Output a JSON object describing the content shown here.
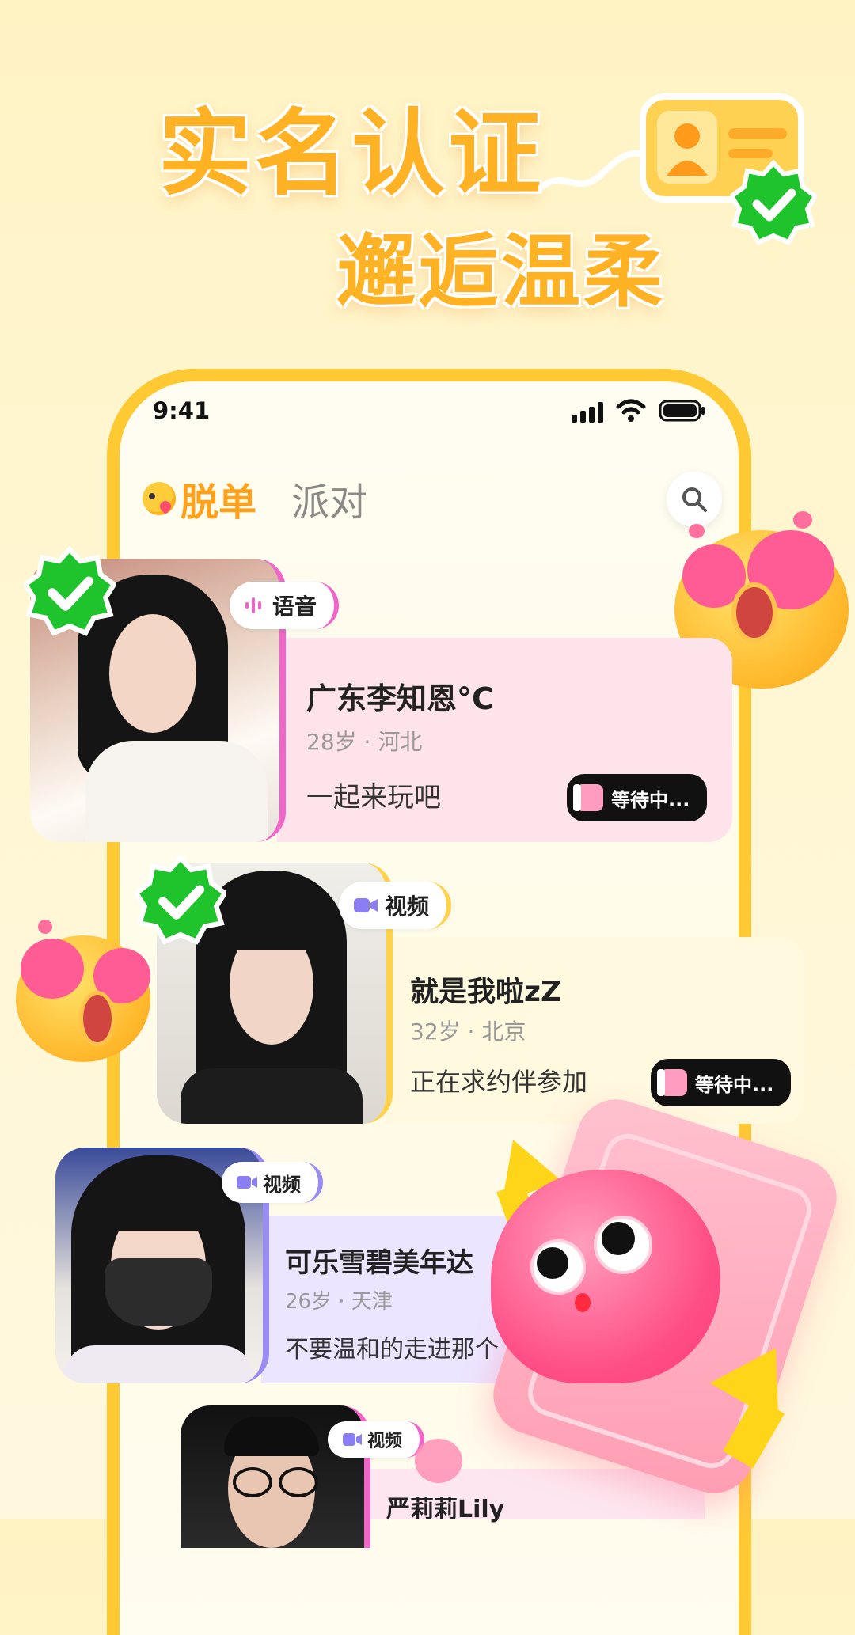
{
  "headline": {
    "line1": "实名认证",
    "line2": "邂逅温柔"
  },
  "status_bar": {
    "time": "9:41"
  },
  "tabs": [
    {
      "label": "脱单",
      "active": true
    },
    {
      "label": "派对",
      "active": false
    }
  ],
  "icons": {
    "id_card": "id-card-icon",
    "verified": "verified-badge-icon",
    "search": "search-icon",
    "voice": "voice-wave-icon",
    "video": "video-camera-icon",
    "heart_eyes": "heart-eyes-emoji-icon",
    "heart_phone": "heart-mascot-phone-icon"
  },
  "colors": {
    "accent": "#ffa11a",
    "frame": "#ffc934",
    "verified": "#1fc42d",
    "voice": "#f065c8",
    "video": "#8b7ef5"
  },
  "cards": [
    {
      "name": "广东李知恩°C",
      "age": "28岁",
      "city": "河北",
      "bio": "一起来玩吧",
      "tag": "语音",
      "status": "等待中...",
      "verified": true
    },
    {
      "name": "就是我啦zZ",
      "age": "32岁",
      "city": "北京",
      "bio": "正在求约伴参加",
      "tag": "视频",
      "status": "等待中...",
      "verified": true
    },
    {
      "name": "可乐雪碧美年达",
      "age": "26岁",
      "city": "天津",
      "bio": "不要温和的走进那个",
      "tag": "视频",
      "status": "",
      "verified": false
    },
    {
      "name": "严莉莉Lily",
      "age": "",
      "city": "",
      "bio": "",
      "tag": "视频",
      "status": "",
      "verified": false
    }
  ]
}
